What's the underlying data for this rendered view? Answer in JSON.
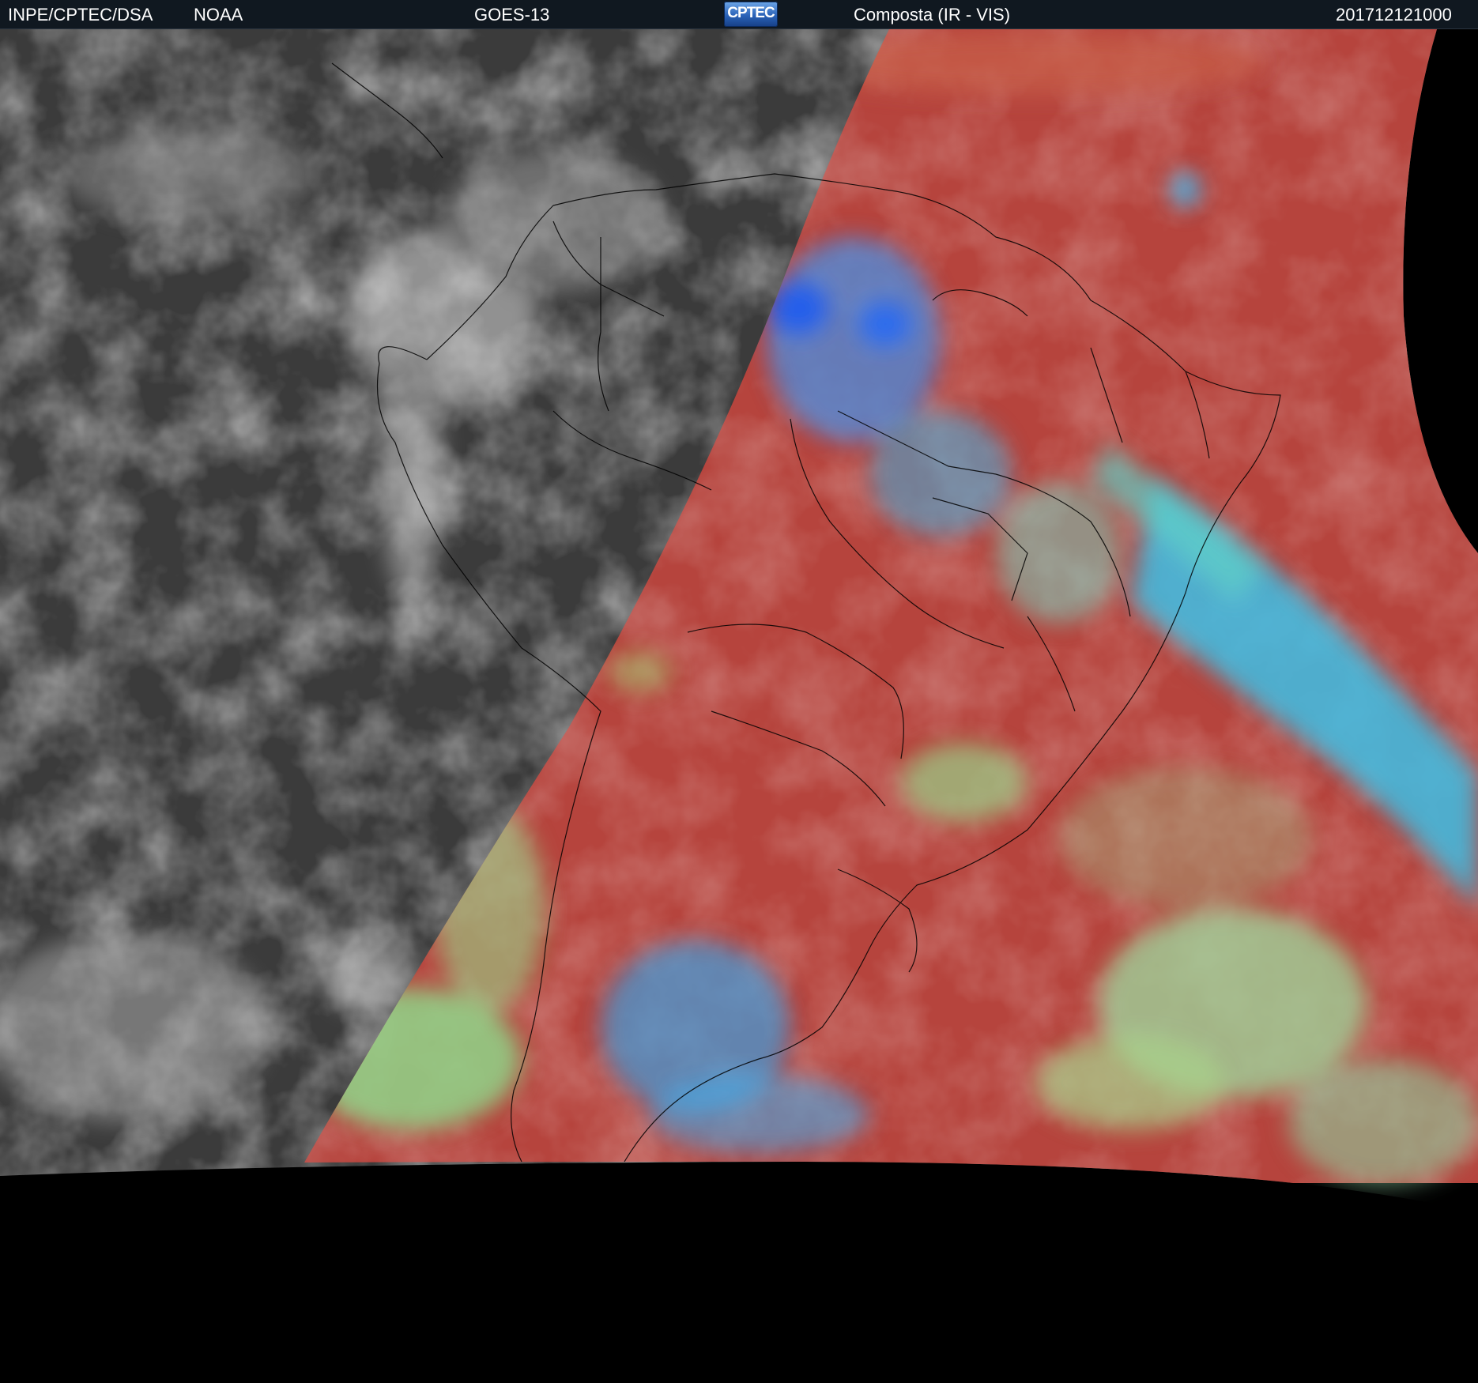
{
  "header": {
    "agency": "INPE/CPTEC/DSA",
    "provider": "NOAA",
    "satellite": "GOES-13",
    "logo_text": "CPTEC",
    "product": "Composta (IR - VIS)",
    "timestamp": "201712121000"
  },
  "colors": {
    "ir_night": "#3a3a3a",
    "vis_surface": "#b8443c",
    "vis_cloud_cyan": "#46c8e8",
    "vis_cloud_green": "#8fd68a",
    "off_disk": "#000000"
  }
}
